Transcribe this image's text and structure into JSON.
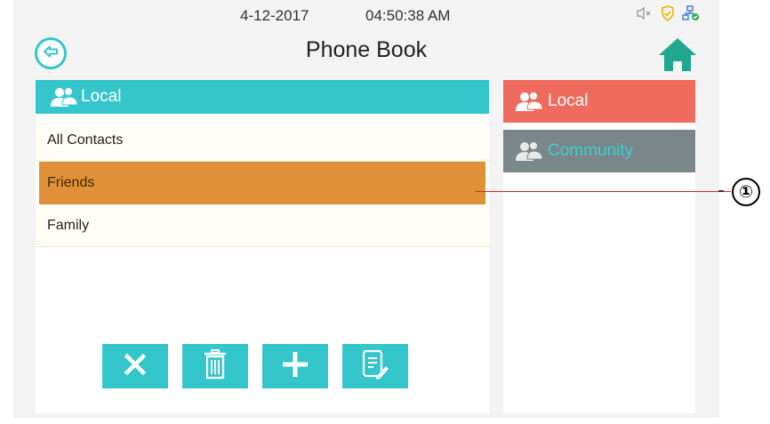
{
  "status": {
    "date": "4-12-2017",
    "time": "04:50:38 AM",
    "icons": [
      "speaker-muted-icon",
      "shield-icon",
      "network-connected-icon"
    ]
  },
  "header": {
    "title": "Phone Book",
    "back_icon": "back-arrow-icon",
    "home_icon": "home-icon"
  },
  "left_panel": {
    "header_label": "Local",
    "contacts": [
      {
        "label": "All Contacts",
        "selected": false
      },
      {
        "label": "Friends",
        "selected": true
      },
      {
        "label": "Family",
        "selected": false
      }
    ],
    "toolbar": [
      "close-icon",
      "trash-icon",
      "plus-icon",
      "edit-list-icon"
    ]
  },
  "right_panel": {
    "tabs": [
      {
        "label": "Local",
        "active": true
      },
      {
        "label": "Community",
        "active": false
      }
    ]
  },
  "callout": {
    "marker": "①"
  },
  "colors": {
    "accent": "#35c6cc",
    "selected_row": "#e09138",
    "tab_active": "#ef6b5d",
    "tab_inactive": "#7b8688",
    "home_green": "#1fa88f"
  }
}
